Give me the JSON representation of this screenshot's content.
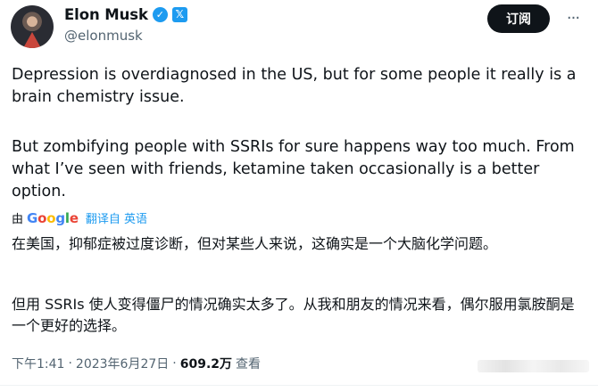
{
  "author": {
    "name": "Elon Musk",
    "handle": "@elonmusk",
    "verified_icon": "verified-badge-icon",
    "affiliation_icon": "x-affiliation-icon"
  },
  "header": {
    "subscribe_label": "订阅",
    "more_label": "···"
  },
  "tweet": {
    "paragraph1": "Depression is overdiagnosed in the US, but for some people it really is a brain chemistry issue.",
    "paragraph2": "But zombifying people with SSRIs for sure happens way too much. From what I’ve seen with friends, ketamine taken occasionally is a better option."
  },
  "translation": {
    "by_label": "由",
    "provider": "Google",
    "action_label": "翻译自 英语",
    "paragraph1": "在美国，抑郁症被过度诊断，但对某些人来说，这确实是一个大脑化学问题。",
    "paragraph2": "但用 SSRIs 使人变得僵尸的情况确实太多了。从我和朋友的情况来看，偶尔服用氯胺酮是一个更好的选择。"
  },
  "meta": {
    "time": "下午1:41",
    "separator": "·",
    "date": "2023年6月27日",
    "views": "609.2万",
    "views_label": "查看"
  },
  "colors": {
    "accent": "#1d9bf0",
    "text": "#0f1419",
    "secondary": "#536471",
    "google_blue": "#4285f4",
    "google_red": "#ea4335",
    "google_yellow": "#fbbc05",
    "google_green": "#34a853"
  }
}
